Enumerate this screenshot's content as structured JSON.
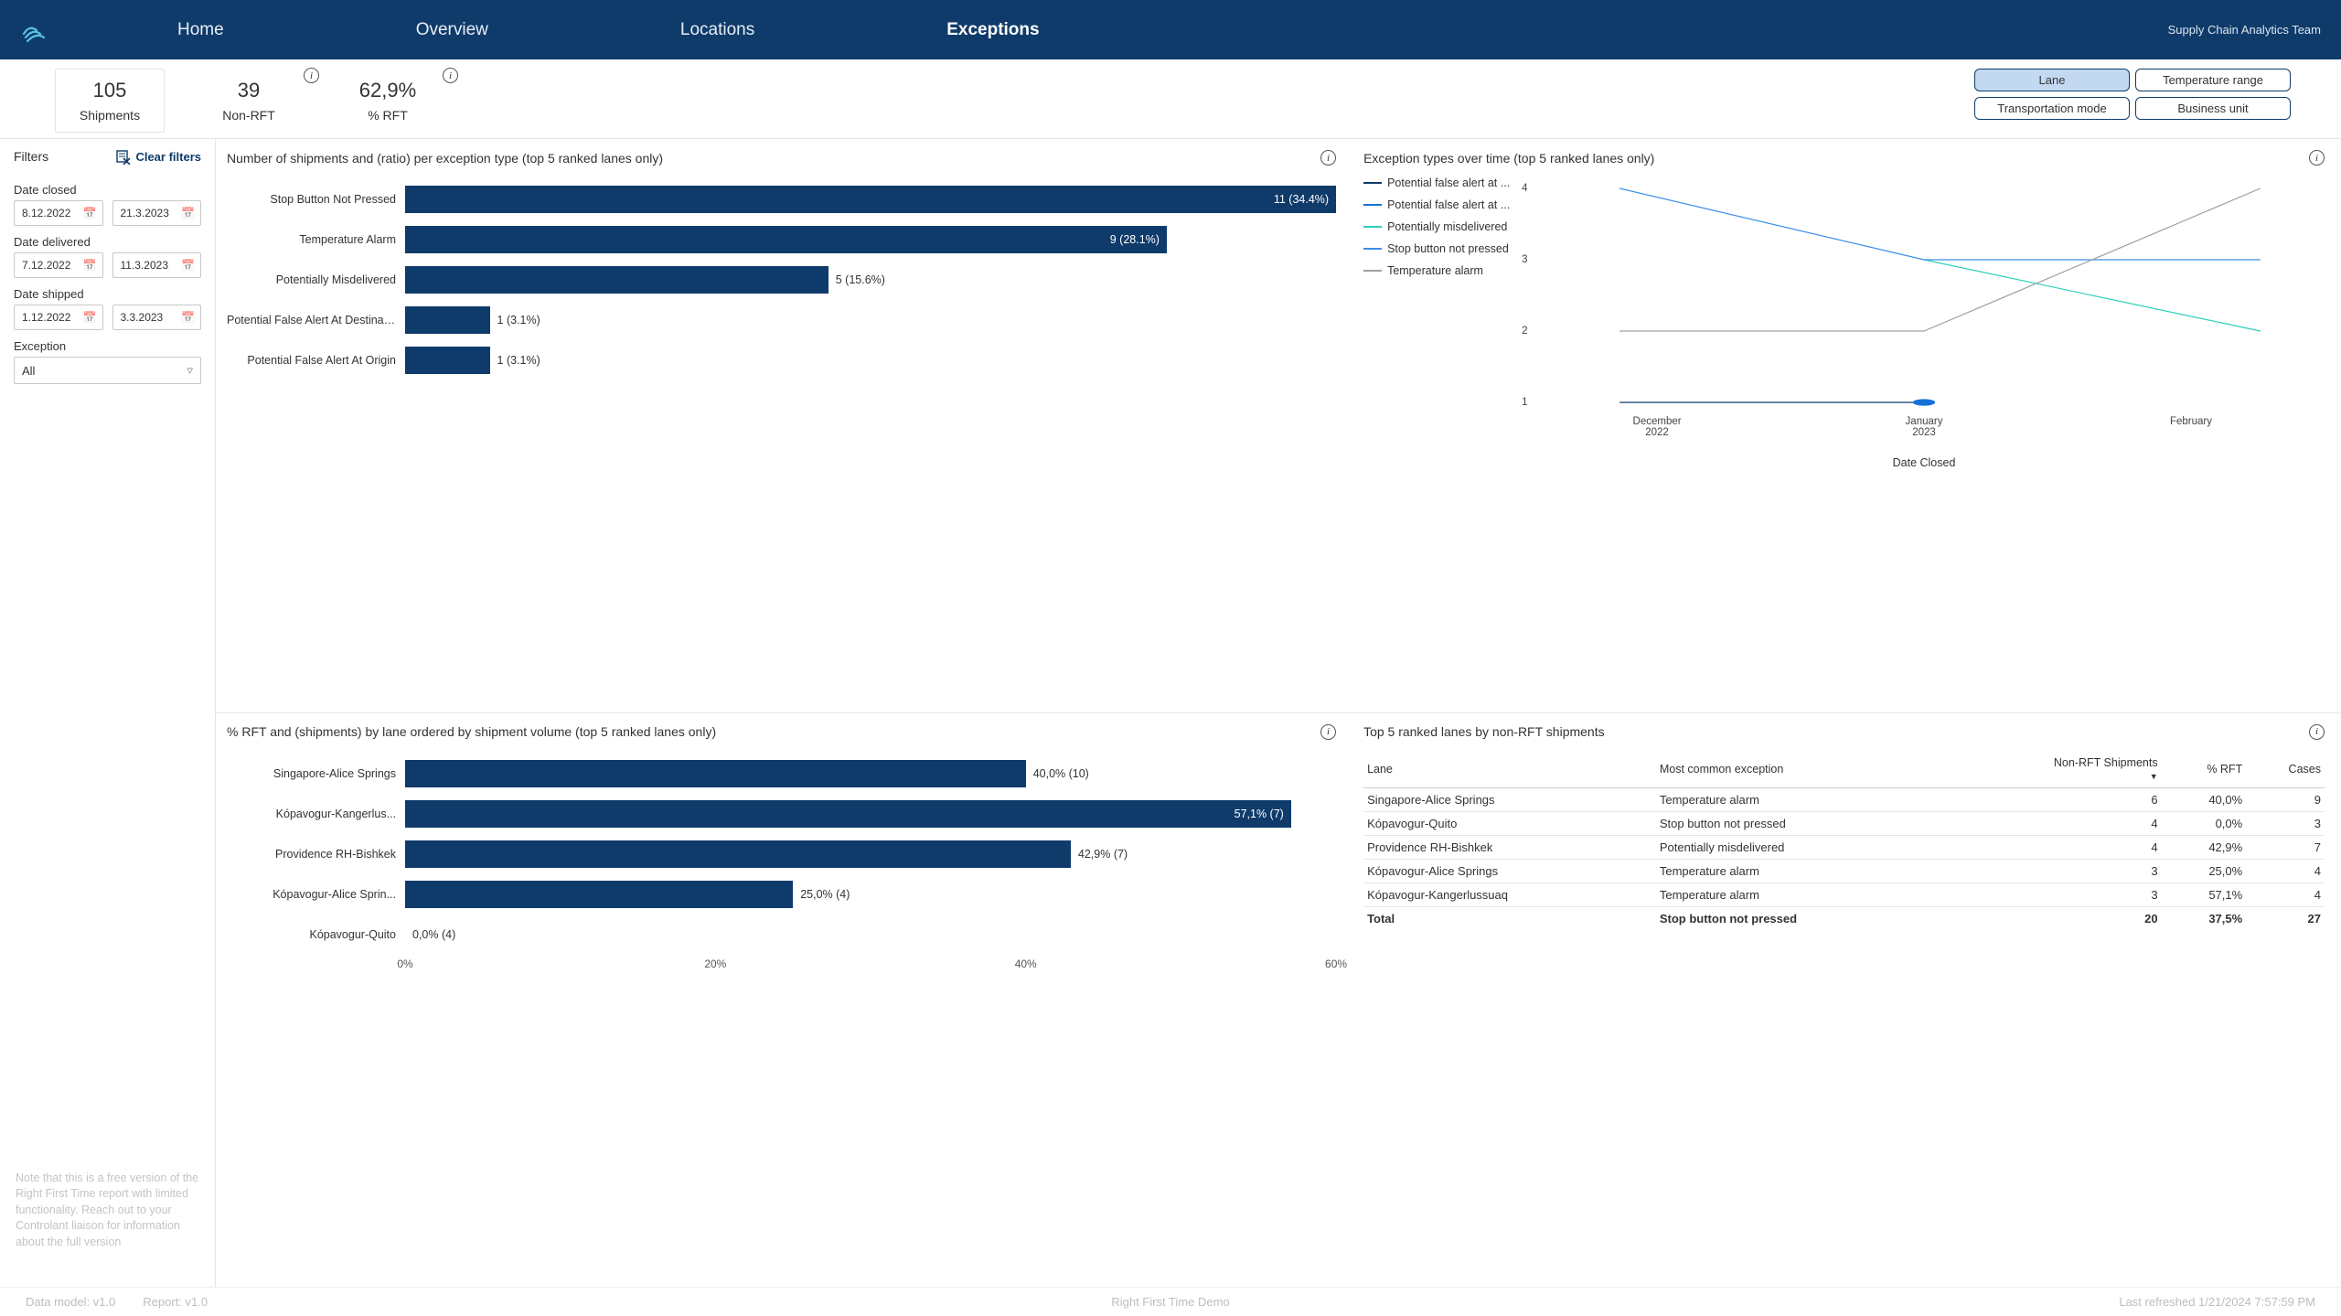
{
  "header": {
    "tabs": [
      "Home",
      "Overview",
      "Locations",
      "Exceptions"
    ],
    "active_tab_index": 3,
    "team": "Supply Chain Analytics Team"
  },
  "kpis": {
    "shipments": {
      "value": "105",
      "label": "Shipments"
    },
    "nonrft": {
      "value": "39",
      "label": "Non-RFT"
    },
    "pctrft": {
      "value": "62,9%",
      "label": "% RFT"
    }
  },
  "pills": {
    "lane": "Lane",
    "temp_range": "Temperature range",
    "transport_mode": "Transportation mode",
    "bu": "Business unit",
    "active": "lane"
  },
  "filters": {
    "title": "Filters",
    "clear": "Clear filters",
    "date_closed": {
      "label": "Date closed",
      "from": "8.12.2022",
      "to": "21.3.2023"
    },
    "date_delivered": {
      "label": "Date delivered",
      "from": "7.12.2022",
      "to": "11.3.2023"
    },
    "date_shipped": {
      "label": "Date shipped",
      "from": "1.12.2022",
      "to": "3.3.2023"
    },
    "exception": {
      "label": "Exception",
      "value": "All"
    },
    "note": "Note that this is a free version of the Right First Time report with limited functionality. Reach out to your Controlant liaison for information about the full version"
  },
  "chart_data": [
    {
      "id": "exception-type-bars",
      "type": "bar",
      "orientation": "horizontal",
      "title": "Number of shipments and (ratio) per exception type (top 5 ranked lanes only)",
      "categories": [
        "Stop Button Not Pressed",
        "Temperature Alarm",
        "Potentially Misdelivered",
        "Potential False Alert At Destinat...",
        "Potential False Alert At Origin"
      ],
      "values": [
        11,
        9,
        5,
        1,
        1
      ],
      "value_labels": [
        "11 (34.4%)",
        "9 (28.1%)",
        "5 (15.6%)",
        "1 (3.1%)",
        "1 (3.1%)"
      ],
      "max": 11
    },
    {
      "id": "exception-over-time",
      "type": "line",
      "title": "Exception types over time (top 5 ranked lanes only)",
      "x": [
        "December 2022",
        "January 2023",
        "February"
      ],
      "ylim": [
        1,
        4
      ],
      "yticks": [
        1,
        2,
        3,
        4
      ],
      "xaxis_title": "Date Closed",
      "series": [
        {
          "name": "Potential false alert at ...",
          "color": "#0f3b6a",
          "values": [
            1,
            1,
            null
          ]
        },
        {
          "name": "Potential false alert at ...",
          "color": "#1671d6",
          "values": [
            null,
            1,
            null
          ]
        },
        {
          "name": "Potentially misdelivered",
          "color": "#2cd1bb",
          "values": [
            null,
            3,
            2
          ]
        },
        {
          "name": "Stop button not pressed",
          "color": "#3c8de8",
          "values": [
            4,
            3,
            3
          ]
        },
        {
          "name": "Temperature alarm",
          "color": "#9aa1a7",
          "values": [
            2,
            2,
            4
          ]
        }
      ],
      "legend_labels": [
        "Potential false alert at ...",
        "Potential false alert at ...",
        "Potentially misdelivered",
        "Stop button not pressed",
        "Temperature alarm"
      ]
    },
    {
      "id": "rft-by-lane",
      "type": "bar",
      "orientation": "horizontal",
      "title": "% RFT and (shipments) by lane ordered by shipment volume (top 5 ranked lanes only)",
      "categories": [
        "Singapore-Alice Springs",
        "Kópavogur-Kangerlus...",
        "Providence RH-Bishkek",
        "Kópavogur-Alice Sprin...",
        "Kópavogur-Quito"
      ],
      "values": [
        40.0,
        57.1,
        42.9,
        25.0,
        0.0
      ],
      "value_labels": [
        "40,0%  (10)",
        "57,1%  (7)",
        "42,9%  (7)",
        "25,0%  (4)",
        "0,0%  (4)"
      ],
      "xticks": [
        0,
        20,
        40,
        60
      ],
      "xtick_labels": [
        "0%",
        "20%",
        "40%",
        "60%"
      ],
      "max": 60
    }
  ],
  "table": {
    "title": "Top 5 ranked lanes by non-RFT shipments",
    "columns": [
      "Lane",
      "Most common exception",
      "Non-RFT Shipments",
      "% RFT",
      "Cases"
    ],
    "sort_col_index": 2,
    "rows": [
      [
        "Singapore-Alice Springs",
        "Temperature alarm",
        "6",
        "40,0%",
        "9"
      ],
      [
        "Kópavogur-Quito",
        "Stop button not pressed",
        "4",
        "0,0%",
        "3"
      ],
      [
        "Providence RH-Bishkek",
        "Potentially misdelivered",
        "4",
        "42,9%",
        "7"
      ],
      [
        "Kópavogur-Alice Springs",
        "Temperature alarm",
        "3",
        "25,0%",
        "4"
      ],
      [
        "Kópavogur-Kangerlussuaq",
        "Temperature alarm",
        "3",
        "57,1%",
        "4"
      ]
    ],
    "total": [
      "Total",
      "Stop button not pressed",
      "20",
      "37,5%",
      "27"
    ]
  },
  "footer": {
    "data_model": "Data model: v1.0",
    "report": "Report: v1.0",
    "center": "Right First Time Demo",
    "refreshed": "Last refreshed 1/21/2024 7:57:59 PM"
  }
}
